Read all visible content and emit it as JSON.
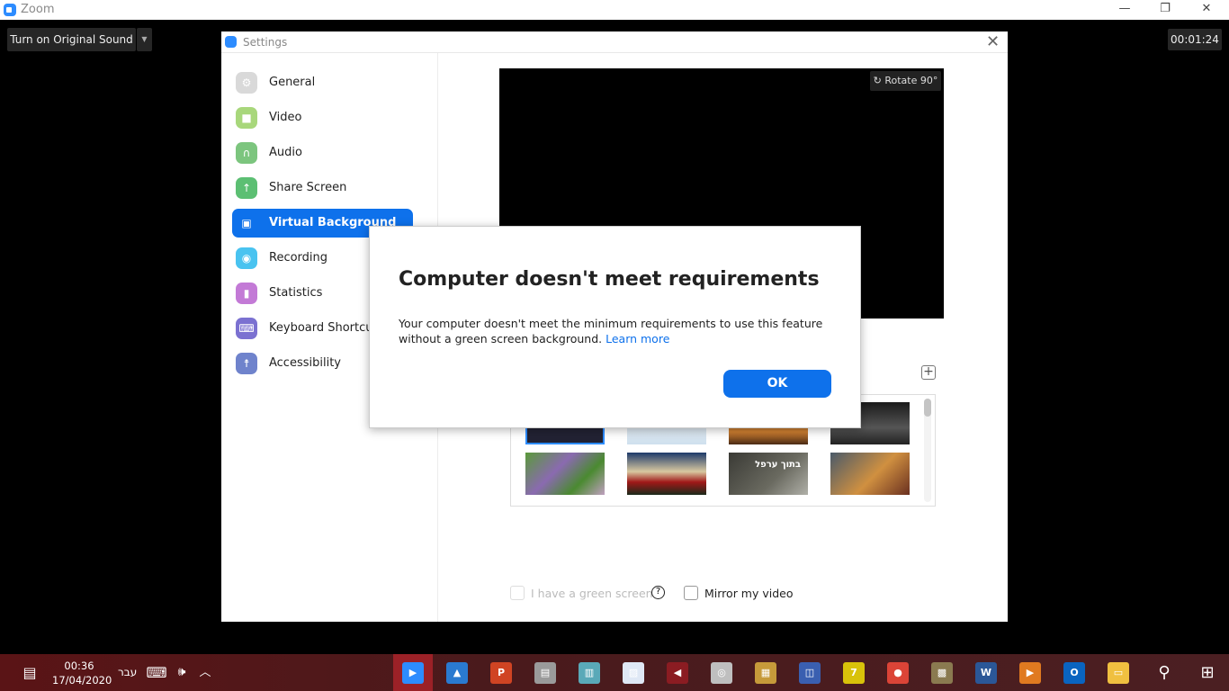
{
  "app": {
    "title": "Zoom",
    "sound_button": "Turn on Original Sound",
    "timer": "00:01:24",
    "minimize": "—",
    "restore": "❐",
    "close": "✕"
  },
  "settings": {
    "title": "Settings",
    "close": "✕",
    "nav": [
      {
        "label": "General",
        "icon": "gear-icon",
        "color": "#d9d9d9",
        "glyph": "⚙"
      },
      {
        "label": "Video",
        "icon": "video-camera-icon",
        "color": "#a8d77b",
        "glyph": "■"
      },
      {
        "label": "Audio",
        "icon": "headphones-icon",
        "color": "#7cc57e",
        "glyph": "∩"
      },
      {
        "label": "Share Screen",
        "icon": "share-screen-icon",
        "color": "#5cbf73",
        "glyph": "↑"
      },
      {
        "label": "Virtual Background",
        "icon": "person-icon",
        "color": "#0e71eb",
        "glyph": "▣"
      },
      {
        "label": "Recording",
        "icon": "record-icon",
        "color": "#49c3f0",
        "glyph": "◉"
      },
      {
        "label": "Statistics",
        "icon": "bar-chart-icon",
        "color": "#c37ad6",
        "glyph": "▮"
      },
      {
        "label": "Keyboard Shortcuts",
        "icon": "keyboard-icon",
        "color": "#7b71d1",
        "glyph": "⌨"
      },
      {
        "label": "Accessibility",
        "icon": "accessibility-icon",
        "color": "#6f83cc",
        "glyph": "☨"
      }
    ],
    "active": "Virtual Background",
    "rotate": "Rotate 90°",
    "add": "+",
    "thumb_caption": "בתוך ערפל",
    "green_screen": "I have a green screen",
    "help": "?",
    "mirror": "Mirror my video"
  },
  "dialog": {
    "title": "Computer doesn't meet requirements",
    "message": "Your computer doesn't meet the minimum requirements to use this feature without a green screen background.",
    "link": "Learn more",
    "ok": "OK"
  },
  "taskbar": {
    "time": "00:36",
    "date": "17/04/2020",
    "lang": "עבר",
    "apps": [
      {
        "name": "zoom",
        "color": "#2d8cff",
        "glyph": "▶"
      },
      {
        "name": "photos",
        "color": "#2a7ad0",
        "glyph": "▲"
      },
      {
        "name": "powerpoint",
        "color": "#d04423",
        "glyph": "P"
      },
      {
        "name": "scanner",
        "color": "#9a9a9a",
        "glyph": "▤"
      },
      {
        "name": "book",
        "color": "#5aa9b8",
        "glyph": "▥"
      },
      {
        "name": "file",
        "color": "#dfe8f5",
        "glyph": "▨"
      },
      {
        "name": "cubase",
        "color": "#8b1c22",
        "glyph": "◀"
      },
      {
        "name": "camera",
        "color": "#bfbfbf",
        "glyph": "◎"
      },
      {
        "name": "map",
        "color": "#c69a3a",
        "glyph": "▦"
      },
      {
        "name": "reader",
        "color": "#3a5fb0",
        "glyph": "◫"
      },
      {
        "name": "7zip",
        "color": "#d8c20a",
        "glyph": "7"
      },
      {
        "name": "chrome",
        "color": "#db4437",
        "glyph": "●"
      },
      {
        "name": "stamp",
        "color": "#8a7a50",
        "glyph": "▩"
      },
      {
        "name": "word",
        "color": "#2b5797",
        "glyph": "W"
      },
      {
        "name": "player",
        "color": "#e07a20",
        "glyph": "▶"
      },
      {
        "name": "outlook",
        "color": "#0a64c0",
        "glyph": "O"
      },
      {
        "name": "explorer",
        "color": "#f0c040",
        "glyph": "▭"
      }
    ]
  }
}
